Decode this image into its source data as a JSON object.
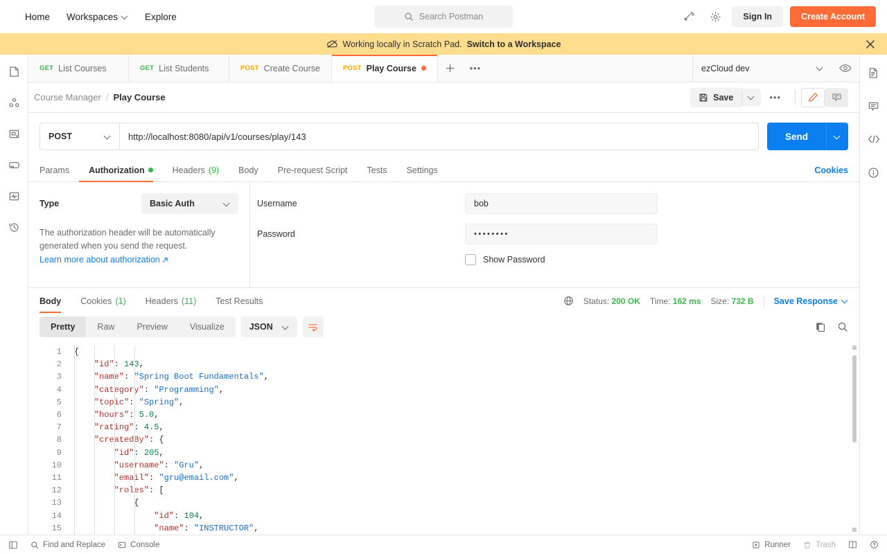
{
  "topnav": {
    "links": [
      {
        "label": "Home",
        "caret": false
      },
      {
        "label": "Workspaces",
        "caret": true
      },
      {
        "label": "Explore",
        "caret": false
      }
    ],
    "search_placeholder": "Search Postman",
    "signin_label": "Sign In",
    "create_label": "Create Account",
    "accent": "#ff6c37"
  },
  "banner": {
    "text": "Working locally in Scratch Pad.",
    "action": "Switch to a Workspace",
    "background": "#ffdd8e"
  },
  "sidebar_rail": {
    "items": [
      {
        "name": "collections-icon"
      },
      {
        "name": "apis-icon"
      },
      {
        "name": "environments-icon"
      },
      {
        "name": "mock-servers-icon"
      },
      {
        "name": "monitors-icon"
      },
      {
        "name": "history-icon"
      }
    ]
  },
  "right_rail": {
    "items": [
      {
        "name": "documentation-icon"
      },
      {
        "name": "comments-icon"
      },
      {
        "name": "code-snippet-icon"
      },
      {
        "name": "info-icon"
      }
    ]
  },
  "tabs": [
    {
      "method": "GET",
      "label": "List Courses",
      "active": false,
      "unsaved": false
    },
    {
      "method": "GET",
      "label": "List Students",
      "active": false,
      "unsaved": false
    },
    {
      "method": "POST",
      "label": "Create Course",
      "active": false,
      "unsaved": false
    },
    {
      "method": "POST",
      "label": "Play Course",
      "active": true,
      "unsaved": true
    }
  ],
  "environment": {
    "selected": "ezCloud dev"
  },
  "breadcrumb": {
    "parent": "Course Manager",
    "separator": "/",
    "current": "Play Course"
  },
  "actions": {
    "save_label": "Save",
    "more_label": "•••"
  },
  "request": {
    "method": "POST",
    "url": "http://localhost:8080/api/v1/courses/play/143",
    "send_label": "Send",
    "tabs": [
      {
        "label": "Params",
        "active": false,
        "indicator": "",
        "count": ""
      },
      {
        "label": "Authorization",
        "active": true,
        "indicator": "dot",
        "count": ""
      },
      {
        "label": "Headers",
        "active": false,
        "indicator": "",
        "count": "(9)"
      },
      {
        "label": "Body",
        "active": false,
        "indicator": "",
        "count": ""
      },
      {
        "label": "Pre-request Script",
        "active": false,
        "indicator": "",
        "count": ""
      },
      {
        "label": "Tests",
        "active": false,
        "indicator": "",
        "count": ""
      },
      {
        "label": "Settings",
        "active": false,
        "indicator": "",
        "count": ""
      }
    ],
    "cookies_link": "Cookies"
  },
  "authorization": {
    "type_label": "Type",
    "type_value": "Basic Auth",
    "description": "The authorization header will be automatically generated when you send the request.",
    "learn_more": "Learn more about authorization",
    "username_label": "Username",
    "username_value": "bob",
    "password_label": "Password",
    "password_value": "••••••••",
    "show_password_label": "Show Password",
    "show_password_checked": false
  },
  "response": {
    "tabs": [
      {
        "label": "Body",
        "count": "",
        "active": true
      },
      {
        "label": "Cookies",
        "count": "(1)",
        "active": false
      },
      {
        "label": "Headers",
        "count": "(11)",
        "active": false
      },
      {
        "label": "Test Results",
        "count": "",
        "active": false
      }
    ],
    "status_label": "Status:",
    "status_value": "200 OK",
    "time_label": "Time:",
    "time_value": "162 ms",
    "size_label": "Size:",
    "size_value": "732 B",
    "save_response_label": "Save Response",
    "view_modes": [
      {
        "label": "Pretty",
        "active": true
      },
      {
        "label": "Raw",
        "active": false
      },
      {
        "label": "Preview",
        "active": false
      },
      {
        "label": "Visualize",
        "active": false
      }
    ],
    "format": "JSON",
    "body_lines": [
      {
        "num": 1,
        "indent": 0,
        "tokens": [
          {
            "t": "p",
            "v": "{"
          }
        ]
      },
      {
        "num": 2,
        "indent": 1,
        "tokens": [
          {
            "t": "k",
            "v": "\"id\""
          },
          {
            "t": "p",
            "v": ": "
          },
          {
            "t": "n",
            "v": "143"
          },
          {
            "t": "p",
            "v": ","
          }
        ]
      },
      {
        "num": 3,
        "indent": 1,
        "tokens": [
          {
            "t": "k",
            "v": "\"name\""
          },
          {
            "t": "p",
            "v": ": "
          },
          {
            "t": "s",
            "v": "\"Spring Boot Fundamentals\""
          },
          {
            "t": "p",
            "v": ","
          }
        ]
      },
      {
        "num": 4,
        "indent": 1,
        "tokens": [
          {
            "t": "k",
            "v": "\"category\""
          },
          {
            "t": "p",
            "v": ": "
          },
          {
            "t": "s",
            "v": "\"Programming\""
          },
          {
            "t": "p",
            "v": ","
          }
        ]
      },
      {
        "num": 5,
        "indent": 1,
        "tokens": [
          {
            "t": "k",
            "v": "\"topic\""
          },
          {
            "t": "p",
            "v": ": "
          },
          {
            "t": "s",
            "v": "\"Spring\""
          },
          {
            "t": "p",
            "v": ","
          }
        ]
      },
      {
        "num": 6,
        "indent": 1,
        "tokens": [
          {
            "t": "k",
            "v": "\"hours\""
          },
          {
            "t": "p",
            "v": ": "
          },
          {
            "t": "n",
            "v": "5.0"
          },
          {
            "t": "p",
            "v": ","
          }
        ]
      },
      {
        "num": 7,
        "indent": 1,
        "tokens": [
          {
            "t": "k",
            "v": "\"rating\""
          },
          {
            "t": "p",
            "v": ": "
          },
          {
            "t": "n",
            "v": "4.5"
          },
          {
            "t": "p",
            "v": ","
          }
        ]
      },
      {
        "num": 8,
        "indent": 1,
        "tokens": [
          {
            "t": "k",
            "v": "\"createdBy\""
          },
          {
            "t": "p",
            "v": ": {"
          }
        ]
      },
      {
        "num": 9,
        "indent": 2,
        "tokens": [
          {
            "t": "k",
            "v": "\"id\""
          },
          {
            "t": "p",
            "v": ": "
          },
          {
            "t": "n",
            "v": "205"
          },
          {
            "t": "p",
            "v": ","
          }
        ]
      },
      {
        "num": 10,
        "indent": 2,
        "tokens": [
          {
            "t": "k",
            "v": "\"username\""
          },
          {
            "t": "p",
            "v": ": "
          },
          {
            "t": "s",
            "v": "\"Gru\""
          },
          {
            "t": "p",
            "v": ","
          }
        ]
      },
      {
        "num": 11,
        "indent": 2,
        "tokens": [
          {
            "t": "k",
            "v": "\"email\""
          },
          {
            "t": "p",
            "v": ": "
          },
          {
            "t": "s",
            "v": "\"gru@email.com\""
          },
          {
            "t": "p",
            "v": ","
          }
        ]
      },
      {
        "num": 12,
        "indent": 2,
        "tokens": [
          {
            "t": "k",
            "v": "\"roles\""
          },
          {
            "t": "p",
            "v": ": ["
          }
        ]
      },
      {
        "num": 13,
        "indent": 3,
        "tokens": [
          {
            "t": "p",
            "v": "{"
          }
        ]
      },
      {
        "num": 14,
        "indent": 4,
        "tokens": [
          {
            "t": "k",
            "v": "\"id\""
          },
          {
            "t": "p",
            "v": ": "
          },
          {
            "t": "n",
            "v": "104"
          },
          {
            "t": "p",
            "v": ","
          }
        ]
      },
      {
        "num": 15,
        "indent": 4,
        "tokens": [
          {
            "t": "k",
            "v": "\"name\""
          },
          {
            "t": "p",
            "v": ": "
          },
          {
            "t": "s",
            "v": "\"INSTRUCTOR\""
          },
          {
            "t": "p",
            "v": ","
          }
        ]
      }
    ]
  },
  "statusbar": {
    "find_replace": "Find and Replace",
    "console": "Console",
    "runner": "Runner",
    "trash": "Trash"
  }
}
